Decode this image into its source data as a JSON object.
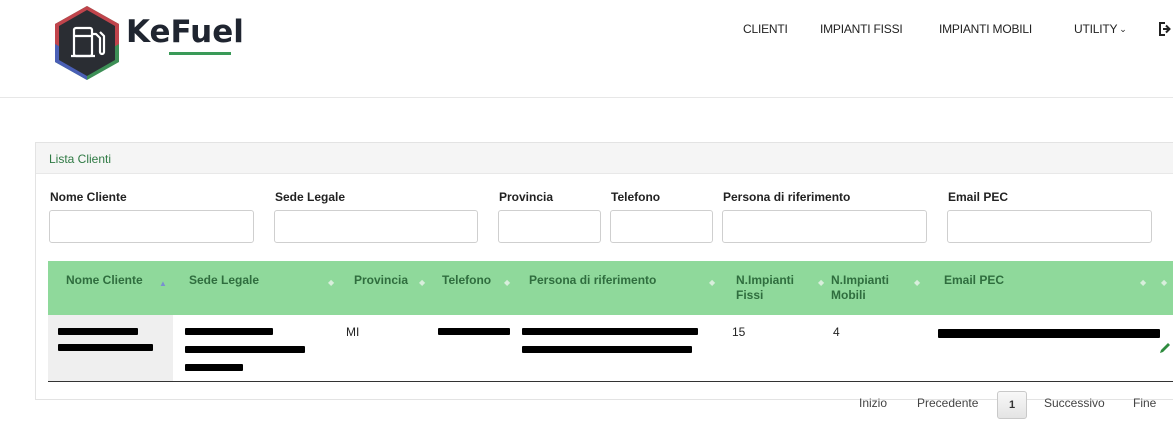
{
  "app": {
    "brand": "KeFuel"
  },
  "nav": {
    "items": [
      "CLIENTI",
      "IMPIANTI FISSI",
      "IMPIANTI MOBILI",
      "UTILITY"
    ],
    "utility_chevron": "⌄"
  },
  "panel": {
    "title": "Lista Clienti"
  },
  "filters": [
    {
      "label": "Nome Cliente",
      "value": ""
    },
    {
      "label": "Sede Legale",
      "value": ""
    },
    {
      "label": "Provincia",
      "value": ""
    },
    {
      "label": "Telefono",
      "value": ""
    },
    {
      "label": "Persona di riferimento",
      "value": ""
    },
    {
      "label": "Email PEC",
      "value": ""
    }
  ],
  "table": {
    "columns": [
      {
        "label": "Nome Cliente",
        "sort": "asc"
      },
      {
        "label": "Sede Legale",
        "sort": "both"
      },
      {
        "label": "Provincia",
        "sort": "both"
      },
      {
        "label": "Telefono",
        "sort": "both"
      },
      {
        "label": "Persona di riferimento",
        "sort": "both"
      },
      {
        "label": "N.Impianti Fissi",
        "sort": "both"
      },
      {
        "label": "N.Impianti Mobili",
        "sort": "both"
      },
      {
        "label": "Email PEC",
        "sort": "both"
      }
    ],
    "rows": [
      {
        "nome_cliente": "[redacted]",
        "sede_legale": "[redacted]",
        "provincia": "MI",
        "telefono": "[redacted]",
        "persona": "[redacted]",
        "impianti_fissi": "15",
        "impianti_mobili": "4",
        "email_pec": "[redacted]",
        "action_icon": "pencil-icon"
      }
    ]
  },
  "pagination": {
    "first": "Inizio",
    "prev": "Precedente",
    "current": "1",
    "next": "Successivo",
    "last": "Fine"
  },
  "colors": {
    "table_header_bg": "#8fd99b",
    "table_header_text": "#2f6d3e",
    "panel_title": "#2f7a44",
    "logo_accent": "#3a9a58"
  }
}
